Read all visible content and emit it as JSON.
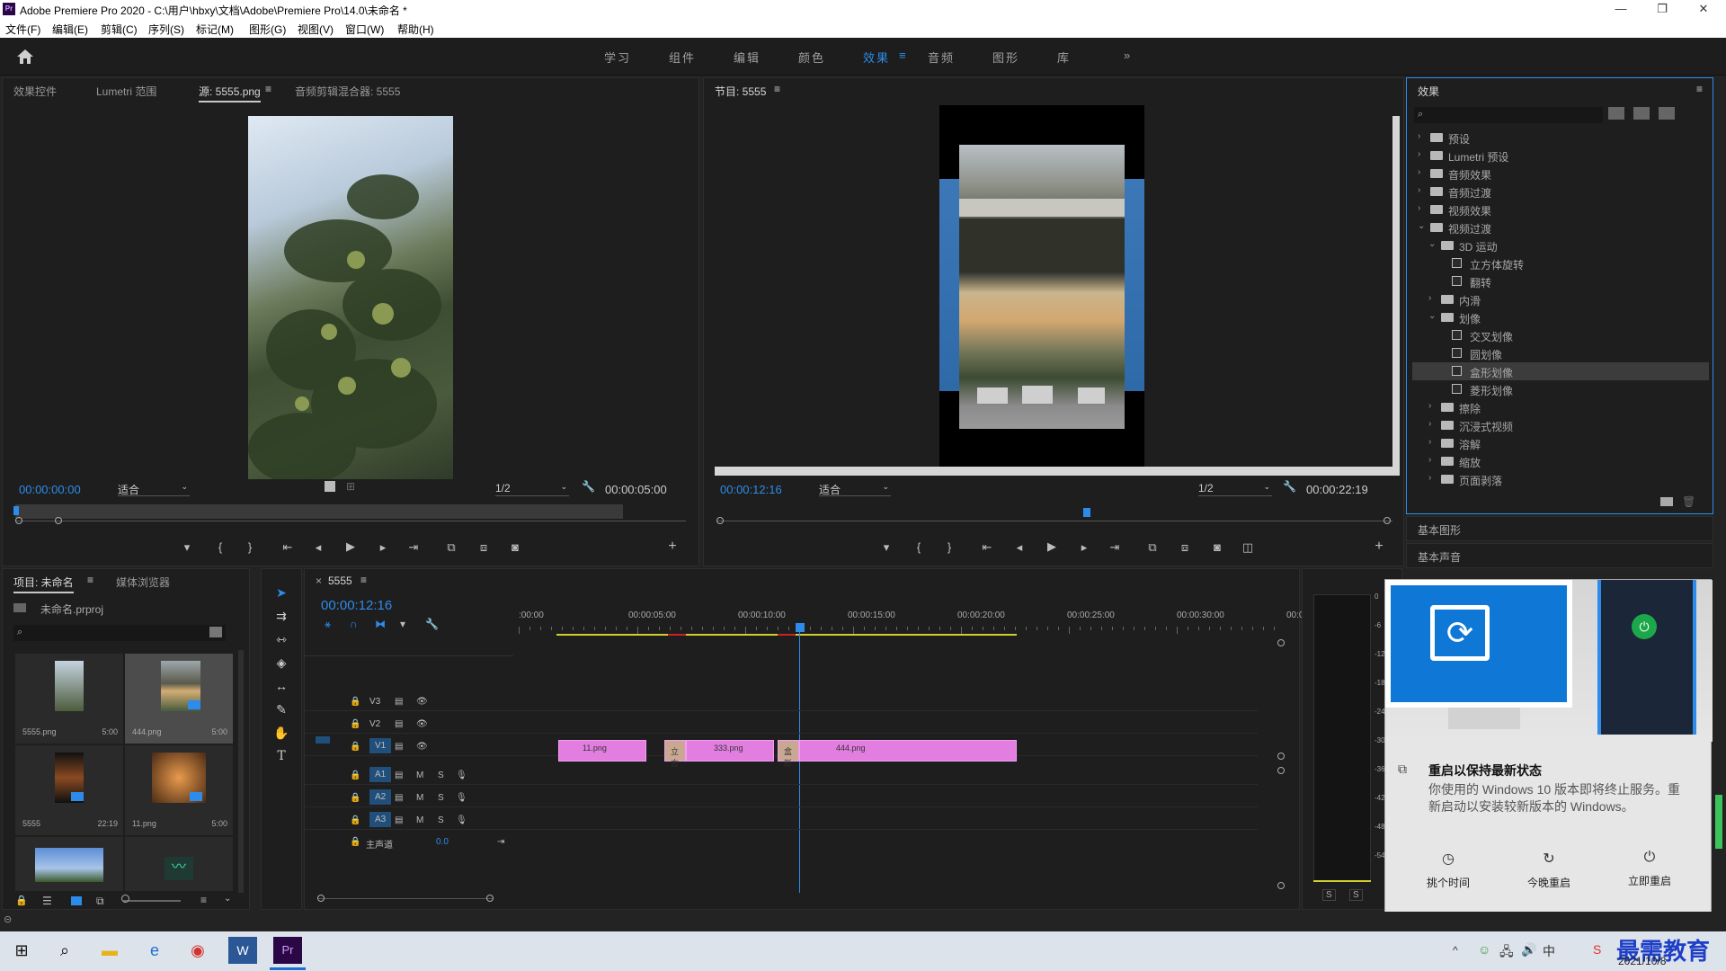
{
  "window": {
    "title": "Adobe Premiere Pro 2020 - C:\\用户\\hbxy\\文档\\Adobe\\Premiere Pro\\14.0\\未命名 *",
    "minimize": "—",
    "maximize": "❐",
    "close": "✕"
  },
  "menu": [
    "文件(F)",
    "编辑(E)",
    "剪辑(C)",
    "序列(S)",
    "标记(M)",
    "图形(G)",
    "视图(V)",
    "窗口(W)",
    "帮助(H)"
  ],
  "workspaces": [
    "学习",
    "组件",
    "编辑",
    "颜色",
    "效果",
    "音频",
    "图形",
    "库"
  ],
  "workspace_active": "效果",
  "workspace_more": "»",
  "source_panel": {
    "tabs": [
      "效果控件",
      "Lumetri 范围",
      "源: 5555.png",
      "音频剪辑混合器: 5555"
    ],
    "timecode_in": "00:00:00:00",
    "fit": "适合",
    "resolution": "1/2",
    "timecode_dur": "00:00:05:00"
  },
  "program_panel": {
    "title": "节目: 5555",
    "timecode": "00:00:12:16",
    "fit": "适合",
    "resolution": "1/2",
    "duration": "00:00:22:19"
  },
  "effects_panel": {
    "title": "效果",
    "tree": [
      {
        "label": "预设",
        "level": 0,
        "kind": "folder",
        "open": false
      },
      {
        "label": "Lumetri 预设",
        "level": 0,
        "kind": "folder",
        "open": false
      },
      {
        "label": "音频效果",
        "level": 0,
        "kind": "folder",
        "open": false
      },
      {
        "label": "音频过渡",
        "level": 0,
        "kind": "folder",
        "open": false
      },
      {
        "label": "视频效果",
        "level": 0,
        "kind": "folder",
        "open": false
      },
      {
        "label": "视频过渡",
        "level": 0,
        "kind": "folder",
        "open": true
      },
      {
        "label": "3D 运动",
        "level": 1,
        "kind": "folder",
        "open": true
      },
      {
        "label": "立方体旋转",
        "level": 2,
        "kind": "fx"
      },
      {
        "label": "翻转",
        "level": 2,
        "kind": "fx"
      },
      {
        "label": "内滑",
        "level": 1,
        "kind": "folder",
        "open": false
      },
      {
        "label": "划像",
        "level": 1,
        "kind": "folder",
        "open": true
      },
      {
        "label": "交叉划像",
        "level": 2,
        "kind": "fx"
      },
      {
        "label": "圆划像",
        "level": 2,
        "kind": "fx"
      },
      {
        "label": "盒形划像",
        "level": 2,
        "kind": "fx",
        "selected": true
      },
      {
        "label": "菱形划像",
        "level": 2,
        "kind": "fx"
      },
      {
        "label": "擦除",
        "level": 1,
        "kind": "folder",
        "open": false
      },
      {
        "label": "沉浸式视频",
        "level": 1,
        "kind": "folder",
        "open": false
      },
      {
        "label": "溶解",
        "level": 1,
        "kind": "folder",
        "open": false
      },
      {
        "label": "缩放",
        "level": 1,
        "kind": "folder",
        "open": false
      },
      {
        "label": "页面剥落",
        "level": 1,
        "kind": "folder",
        "open": false
      }
    ],
    "basic_graphics": "基本图形",
    "basic_sound": "基本声音"
  },
  "project_panel": {
    "tabs": [
      "项目: 未命名",
      "媒体浏览器"
    ],
    "file": "未命名.prproj",
    "items": [
      {
        "name": "5555.png",
        "dur": "5:00"
      },
      {
        "name": "444.png",
        "dur": "5:00"
      },
      {
        "name": "5555",
        "dur": "22:19"
      },
      {
        "name": "11.png",
        "dur": "5:00"
      }
    ]
  },
  "timeline": {
    "tab": "5555",
    "close": "×",
    "timecode": "00:00:12:16",
    "ruler": [
      ":00:00",
      "00:00:05:00",
      "00:00:10:00",
      "00:00:15:00",
      "00:00:20:00",
      "00:00:25:00",
      "00:00:30:00",
      "00:0"
    ],
    "tracks_video": [
      "V3",
      "V2",
      "V1"
    ],
    "tracks_audio": [
      "A1",
      "A2",
      "A3"
    ],
    "source_patch": "V1",
    "master": "主声道",
    "master_val": "0.0",
    "clips": [
      {
        "label": "11.png"
      },
      {
        "label": "立方"
      },
      {
        "label": "333.png"
      },
      {
        "label": "盒形"
      },
      {
        "label": "444.png"
      }
    ],
    "m": "M",
    "s": "S"
  },
  "meter": {
    "ticks": [
      "0",
      "-6",
      "-12",
      "-18",
      "-24",
      "-30",
      "-36",
      "-42",
      "-48",
      "-54"
    ],
    "s_left": "S",
    "s_right": "S"
  },
  "notification": {
    "title": "重启以保持最新状态",
    "body": "你使用的 Windows 10 版本即将终止服务。重新启动以安装较新版本的 Windows。",
    "actions": [
      "挑个时间",
      "今晚重启",
      "立即重启"
    ]
  },
  "taskbar": {
    "date": "2021/10/8",
    "watermark": "最需教育"
  },
  "colors": {
    "accent": "#2d8ceb",
    "clip": "#e27ee0",
    "win_blue": "#0f78d7",
    "playhead": "#2d8ceb"
  }
}
